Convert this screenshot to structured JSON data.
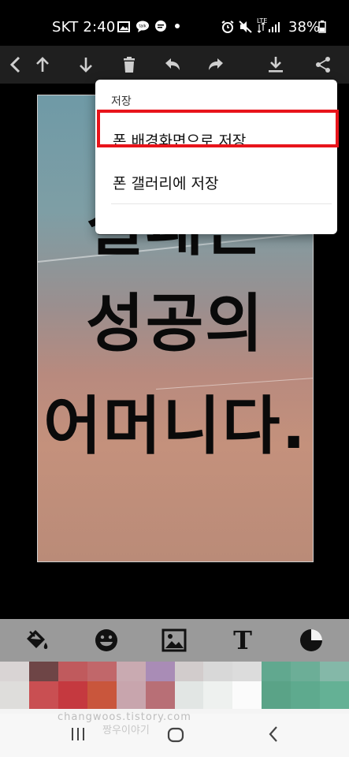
{
  "status_bar": {
    "carrier_time": "SKT 2:40",
    "lte": "LTE",
    "battery": "38%"
  },
  "toolbar": {
    "icons": [
      "chevron-left-icon",
      "arrow-up-icon",
      "arrow-down-icon",
      "trash-icon",
      "undo-icon",
      "redo-icon",
      "download-icon",
      "share-icon"
    ]
  },
  "canvas": {
    "lines": [
      "실패는",
      "성공의",
      "어머니다."
    ]
  },
  "save_menu": {
    "title": "저장",
    "items": [
      "폰 배경화면으로 저장",
      "폰 갤러리에 저장"
    ],
    "highlight_color": "#e8141b"
  },
  "tools": {
    "icons": [
      "paint-bucket-icon",
      "emoji-icon",
      "image-icon",
      "text-icon",
      "opacity-icon"
    ],
    "text_glyph": "T"
  },
  "palette": {
    "row1": [
      "#d9d4d4",
      "#6e4546",
      "#c05a5d",
      "#c1676a",
      "#c9aab1",
      "#a98cb6",
      "#d2cccc",
      "#d8d8d8",
      "#dcdcdc",
      "#61a88f",
      "#6cae97",
      "#84b8a8"
    ],
    "row2": [
      "#dedddb",
      "#c94f52",
      "#c5393f",
      "#c9563c",
      "#c8a5ad",
      "#b86f76",
      "#e2e6e4",
      "#eef1ef",
      "#fbfbfb",
      "#5aa387",
      "#5eaa8e",
      "#64b195"
    ]
  },
  "watermark": {
    "site": "changwoos.tistory.com",
    "name": "짱우이야기"
  },
  "nav": {
    "icons": [
      "recent-apps-icon",
      "home-icon",
      "back-icon"
    ]
  }
}
